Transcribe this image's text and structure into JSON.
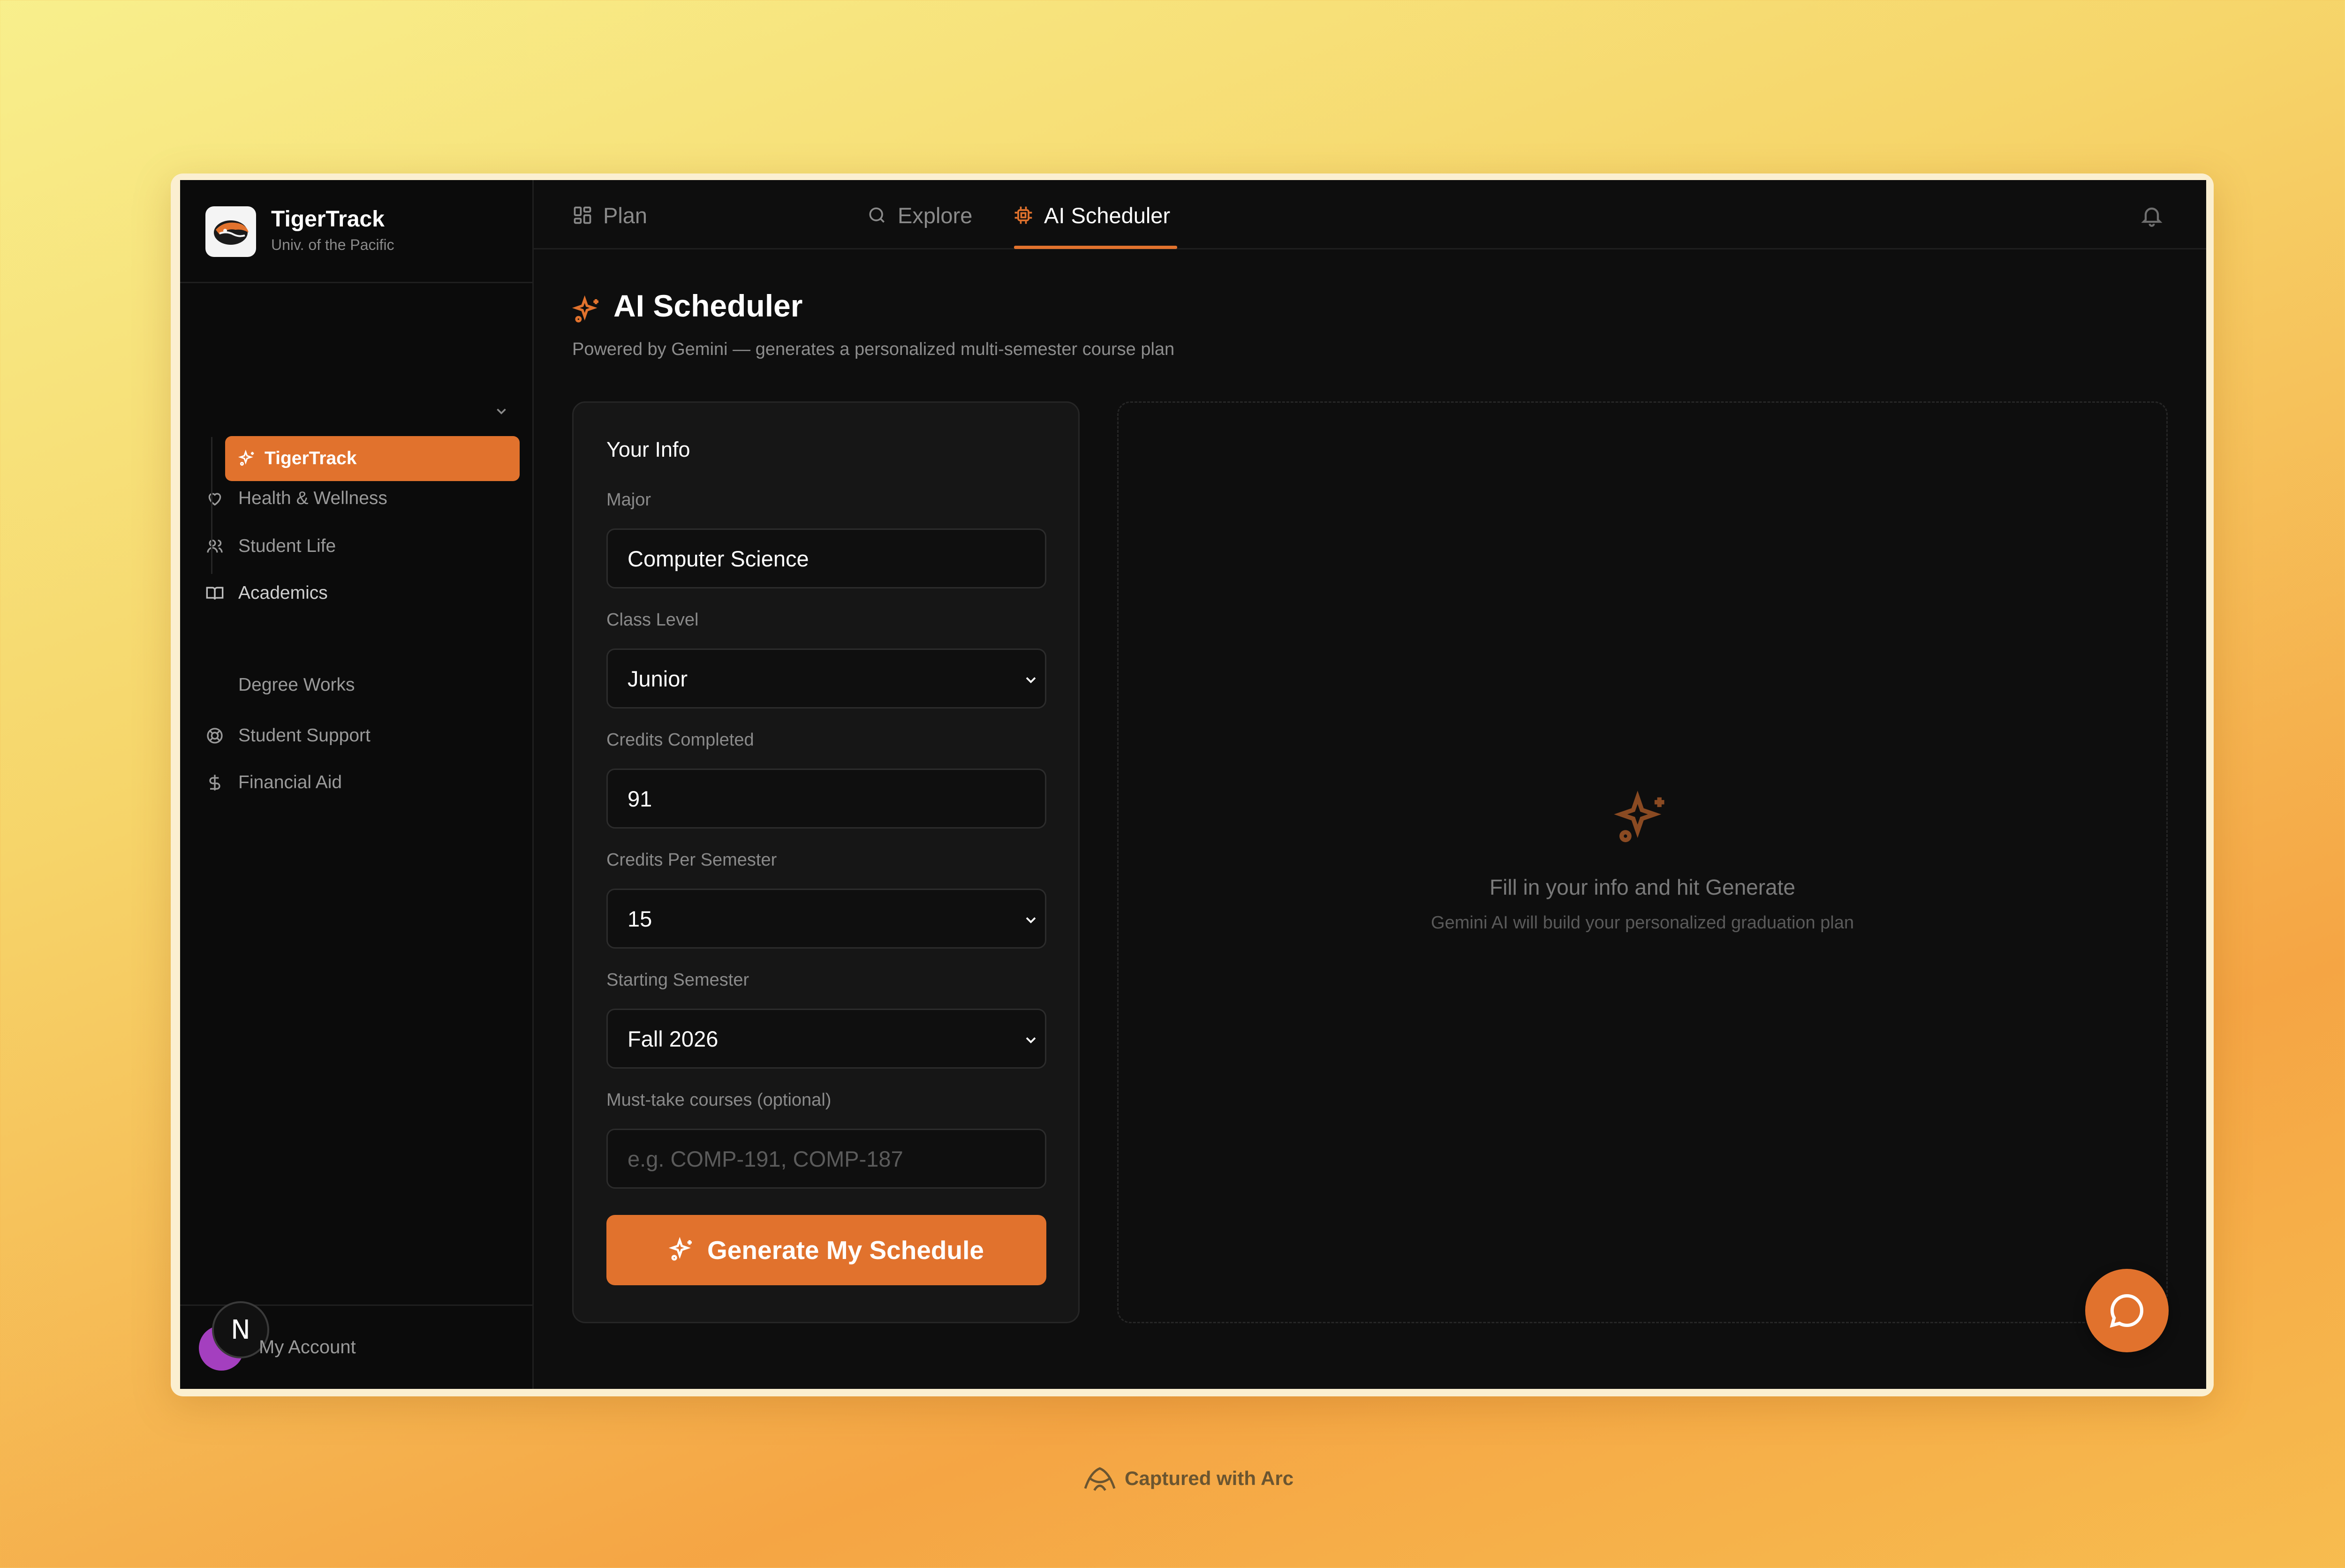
{
  "brand": {
    "name": "TigerTrack",
    "subtitle": "Univ. of the Pacific"
  },
  "sidebar": {
    "items": [
      {
        "label": "Health & Wellness",
        "icon": "heart-icon"
      },
      {
        "label": "Student Life",
        "icon": "users-icon"
      },
      {
        "label": "Academics",
        "icon": "book-icon",
        "expanded": true
      },
      {
        "label": "TigerTrack",
        "icon": "sparkles-icon",
        "active": true
      },
      {
        "label": "Degree Works"
      },
      {
        "label": "Student Support",
        "icon": "lifebuoy-icon"
      },
      {
        "label": "Financial Aid",
        "icon": "dollar-icon"
      }
    ],
    "account_label": "My Account",
    "avatar_letter": "N"
  },
  "tabs": [
    {
      "label": "Plan",
      "icon": "grid-icon"
    },
    {
      "label": "Explore",
      "icon": "search-icon"
    },
    {
      "label": "AI Scheduler",
      "icon": "chip-icon",
      "active": true
    }
  ],
  "page": {
    "title": "AI Scheduler",
    "subtitle": "Powered by Gemini — generates a personalized multi-semester course plan"
  },
  "form": {
    "title": "Your Info",
    "major_label": "Major",
    "major_value": "Computer Science",
    "class_level_label": "Class Level",
    "class_level_value": "Junior",
    "credits_completed_label": "Credits Completed",
    "credits_completed_value": "91",
    "credits_per_semester_label": "Credits Per Semester",
    "credits_per_semester_value": "15",
    "starting_semester_label": "Starting Semester",
    "starting_semester_value": "Fall 2026",
    "must_take_label": "Must-take courses (optional)",
    "must_take_placeholder": "e.g. COMP-191, COMP-187",
    "generate_button": "Generate My Schedule"
  },
  "result": {
    "empty_title": "Fill in your info and hit Generate",
    "empty_subtitle": "Gemini AI will build your personalized graduation plan"
  },
  "footer": {
    "capture_label": "Captured with Arc"
  },
  "colors": {
    "accent": "#e1722d",
    "background": "#0e0e0e",
    "panel": "#161616"
  }
}
